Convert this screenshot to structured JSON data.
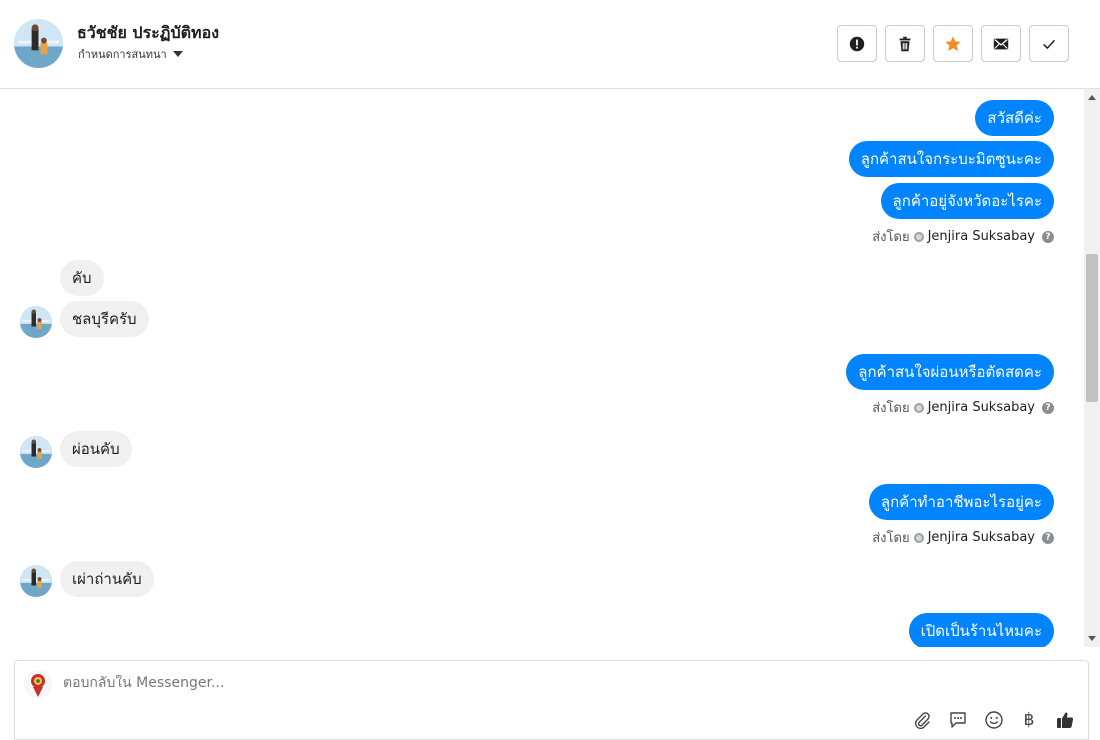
{
  "header": {
    "name": "ธวัชชัย ประฏิบัติทอง",
    "subtitle": "กำหนดการสนทนา"
  },
  "toolbar": {
    "buttons": [
      {
        "name": "spam",
        "icon": "exclamation-icon"
      },
      {
        "name": "delete",
        "icon": "trash-icon"
      },
      {
        "name": "star",
        "icon": "star-icon",
        "color": "#f28c28"
      },
      {
        "name": "mail",
        "icon": "envelope-icon"
      },
      {
        "name": "done",
        "icon": "check-icon"
      }
    ]
  },
  "messages": [
    {
      "dir": "out",
      "text": "สวัสดีค่ะ"
    },
    {
      "dir": "out",
      "text": "ลูกค้าสนใจกระบะมิตซูนะคะ"
    },
    {
      "dir": "out",
      "text": "ลูกค้าอยู่จังหวัดอะไรคะ"
    },
    {
      "dir": "in",
      "text": "คับ"
    },
    {
      "dir": "in",
      "text": "ชลบุรีครับ"
    },
    {
      "dir": "out",
      "text": "ลูกค้าสนใจผ่อนหรือตัดสดคะ"
    },
    {
      "dir": "in",
      "text": "ผ่อนคับ"
    },
    {
      "dir": "out",
      "text": "ลูกค้าทำอาชีพอะไรอยู่คะ"
    },
    {
      "dir": "in",
      "text": "เผ่าถ่านคับ"
    },
    {
      "dir": "out",
      "text": "เปิดเป็นร้านไหมคะ"
    }
  ],
  "sender": {
    "prefix": "ส่งโดย",
    "name": "Jenjira Suksabay",
    "help": "?"
  },
  "composer": {
    "placeholder": "ตอบกลับใน Messenger...",
    "currency_symbol": "฿"
  },
  "colors": {
    "accent": "#0084ff",
    "incoming": "#f0f0f0",
    "star": "#f28c28"
  }
}
